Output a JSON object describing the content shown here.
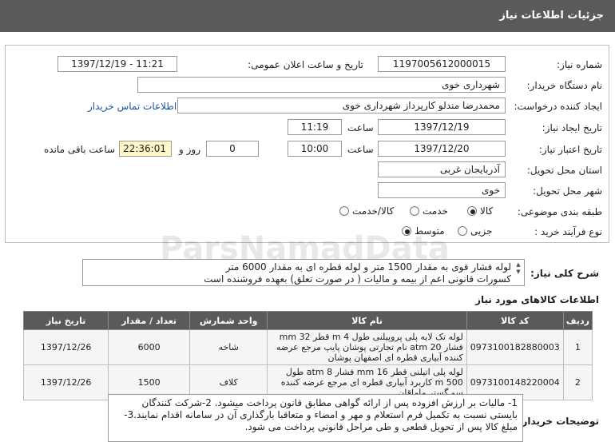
{
  "header": {
    "title": "جزئیات اطلاعات نیاز"
  },
  "fields": {
    "need_number_label": "شماره نیاز:",
    "need_number": "1197005612000015",
    "announce_label": "تاریخ و ساعت اعلان عمومی:",
    "announce_value": "1397/12/19 - 11:21",
    "buyer_org_label": "نام دستگاه خریدار:",
    "buyer_org": "شهرداری خوی",
    "requester_label": "ایجاد کننده درخواست:",
    "requester": "محمدرضا مندلو کارپرداز شهرداری خوی",
    "contact_link": "اطلاعات تماس خریدار",
    "created_label": "تاریخ ایجاد نیاز:",
    "created_date": "1397/12/19",
    "created_time_label": "ساعت",
    "created_time": "11:19",
    "validity_label": "تاریخ اعتبار نیاز:",
    "validity_date": "1397/12/20",
    "validity_time_label": "ساعت",
    "validity_time": "10:00",
    "days_label": "روز و",
    "days": "0",
    "remaining": "22:36:01",
    "remaining_label": "ساعت باقی مانده",
    "province_label": "استان محل تحویل:",
    "province": "آذربایجان غربی",
    "city_label": "شهر محل تحویل:",
    "city": "خوی",
    "category_label": "طبقه بندی موضوعی:",
    "category_options": [
      "کالا",
      "خدمت",
      "کالا/خدمت"
    ],
    "process_label": "نوع فرآیند خرید :",
    "process_options": [
      "جزیی",
      "متوسط"
    ]
  },
  "description": {
    "label": "شرح کلی نیاز:",
    "lines": [
      "لوله فشار قوی به مقدار 1500 متر و لوله قطره ای به مقدار 6000 متر",
      "کسورات قانونی اعم از بیمه و مالیات ( در صورت تعلق) بعهده فروشنده است"
    ]
  },
  "items_section": {
    "title": "اطلاعات کالاهای مورد نیاز",
    "headers": [
      "ردیف",
      "کد کالا",
      "نام کالا",
      "واحد شمارش",
      "تعداد / مقدار",
      "تاریخ نیاز"
    ],
    "rows": [
      {
        "row": "1",
        "code": "0973100182880003",
        "name": "لوله تک لایه پلی پروپیلنی طول 4 m قطر 32 mm فشار 20 atm نام تجارتی پوشان پایپ مرجع عرضه کننده آبیاری قطره ای اصفهان پوشان",
        "unit": "شاخه",
        "qty": "6000",
        "date": "1397/12/26"
      },
      {
        "row": "2",
        "code": "0973100148220004",
        "name": "لوله پلی اتیلنی قطر 16 mm فشار 8 atm طول 500 m کاربرد آبیاری قطره ای مرجع عرضه کننده سو گستر ماماقان",
        "unit": "کلاف",
        "qty": "1500",
        "date": "1397/12/26"
      }
    ]
  },
  "buyer_notes": {
    "label": "توضیحات خریدار:",
    "text": "1- مالیات بر ارزش افزوده پس از ارائه گواهی مطابق قانون پرداخت میشود. 2-شرکت کنندگان بایستی نسبت به تکمیل فرم استعلام  و مهر و امضاء و متعاقبا بارگذاری آن در سامانه اقدام نمایند.3-مبلغ کالا پس از تحویل قطعی  و  طی مراحل قانونی  پرداخت می شود."
  },
  "watermark": "ParsNamadData"
}
